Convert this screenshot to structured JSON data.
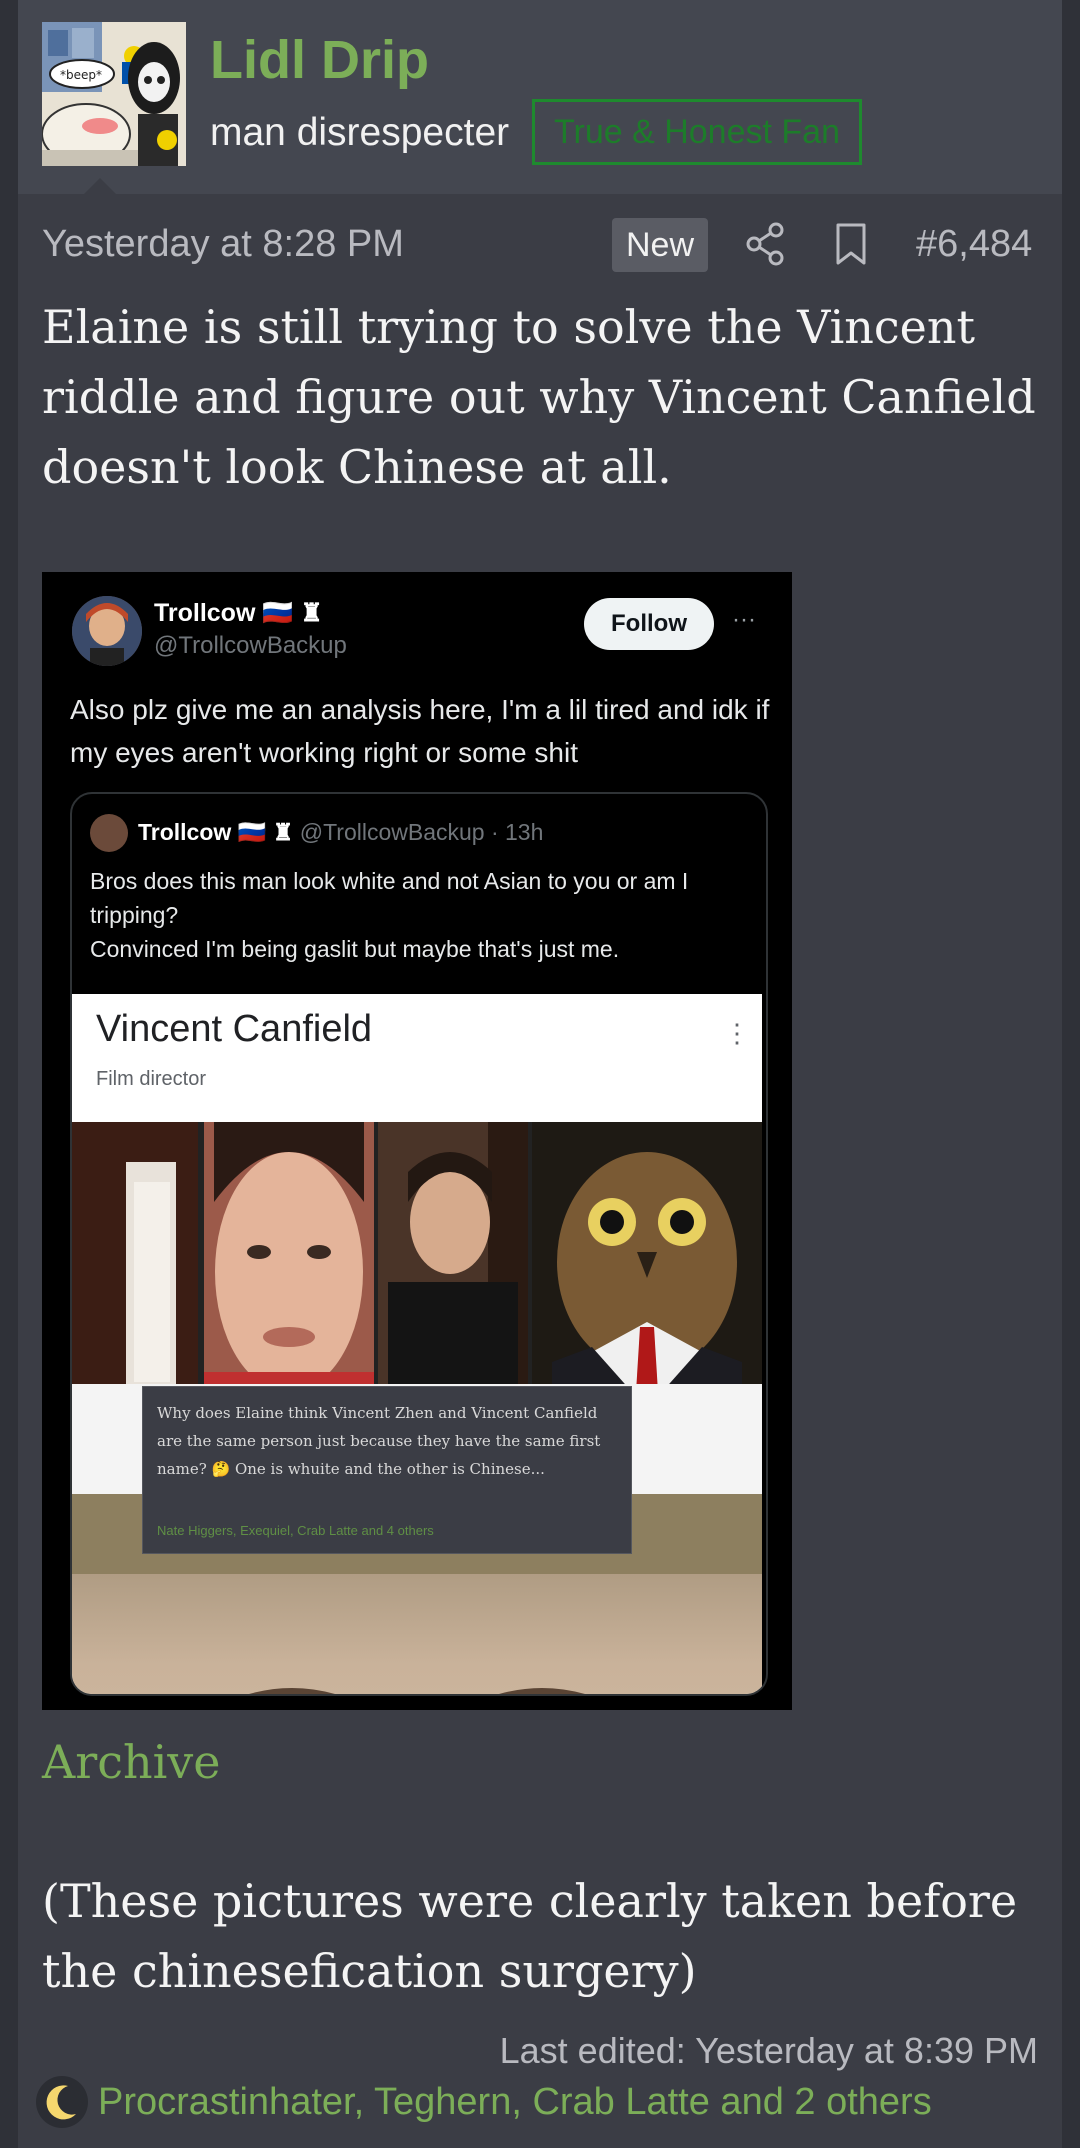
{
  "header": {
    "username": "Lidl Drip",
    "user_title": "man disrespecter",
    "user_badge": "True & Honest Fan",
    "avatar_text": "*beep*"
  },
  "meta": {
    "time": "Yesterday at 8:28 PM",
    "new_badge": "New",
    "post_number": "#6,484"
  },
  "post": {
    "text": "Elaine is still trying to solve the Vincent riddle and figure out why Vincent Canfield doesn't look Chinese at all.",
    "archive_label": "Archive",
    "text_2": "(These pictures were clearly taken before the chinesefication surgery)",
    "last_edited": "Last edited: Yesterday at 8:39 PM"
  },
  "reactions": {
    "icon": "crescent-moon-icon",
    "names": "Procrastinhater, Teghern, Crab Latte and 2 others"
  },
  "embedded": {
    "tweet": {
      "name": "Trollcow 🇷🇺 ♜",
      "handle": "@TrollcowBackup",
      "follow_label": "Follow",
      "more": "···",
      "text": "Also plz give me an analysis here, I'm a lil tired and idk if my eyes aren't working right or some shit"
    },
    "quote": {
      "name": "Trollcow 🇷🇺 ♜",
      "handle_time": "@TrollcowBackup · 13h",
      "text_1": "Bros does this man look white and not Asian to you or am I tripping?",
      "text_2": "Convinced I'm being gaslit but maybe that's just me."
    },
    "knowledge_panel": {
      "title": "Vincent Canfield",
      "subtitle": "Film director",
      "dots": "⋮"
    },
    "comment": {
      "text": "Why does Elaine think Vincent Zhen and Vincent Canfield are the same person just because they have the same first name? 🤔 One is whuite and the other is Chinese...",
      "reactions": "Nate Higgers, Exequiel, Crab Latte and 4 others"
    }
  },
  "colors": {
    "background": "#3b3d45",
    "header_bg": "#444750",
    "username": "#7cae58",
    "link": "#7cae58",
    "badge_border": "#1e8a2e",
    "text": "#f4f4f4",
    "muted": "#b9bac0"
  }
}
